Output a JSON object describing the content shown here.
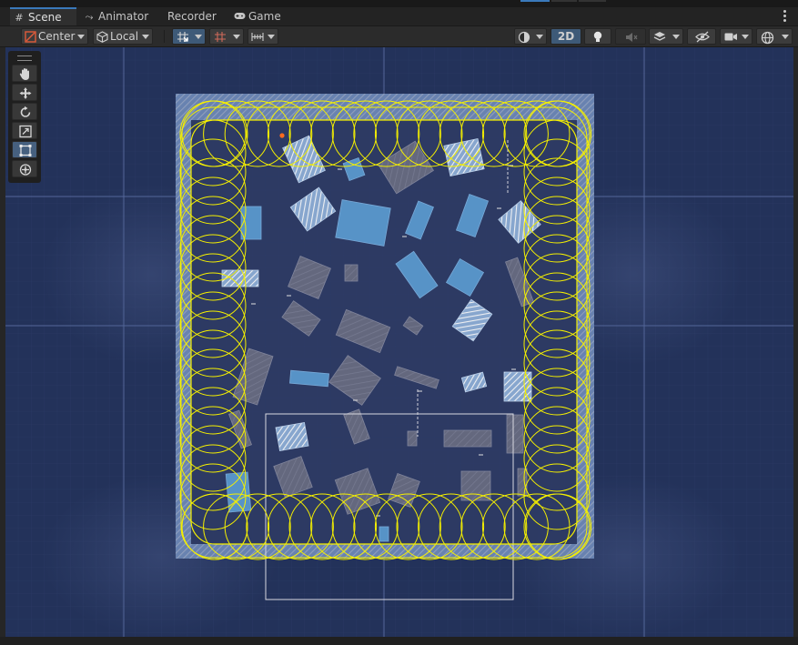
{
  "tabs": [
    {
      "label": "Scene",
      "icon": "grid-icon",
      "active": true
    },
    {
      "label": "Animator",
      "icon": "animator-icon",
      "active": false
    },
    {
      "label": "Recorder",
      "icon": "",
      "active": false
    },
    {
      "label": "Game",
      "icon": "gamepad-icon",
      "active": false
    }
  ],
  "toolbar": {
    "pivot_mode": "Center",
    "pivot_rotation": "Local",
    "mode_2d": "2D"
  },
  "tools": [
    {
      "name": "hand-tool",
      "icon": "hand-icon",
      "active": false
    },
    {
      "name": "move-tool",
      "icon": "move-icon",
      "active": false
    },
    {
      "name": "rotate-tool",
      "icon": "rotate-icon",
      "active": false
    },
    {
      "name": "scale-tool",
      "icon": "scale-icon",
      "active": false
    },
    {
      "name": "rect-tool",
      "icon": "rect-icon",
      "active": true
    },
    {
      "name": "transform-tool",
      "icon": "transform-icon",
      "active": false
    }
  ],
  "colors": {
    "scene_background": "#23325a",
    "grid_line": "#3c4d7a",
    "collider_gizmo": "#f5f000",
    "sprite_blue": "#5b9bd0",
    "sprite_grey": "#6f6f7f",
    "accent": "#3a79bb"
  }
}
